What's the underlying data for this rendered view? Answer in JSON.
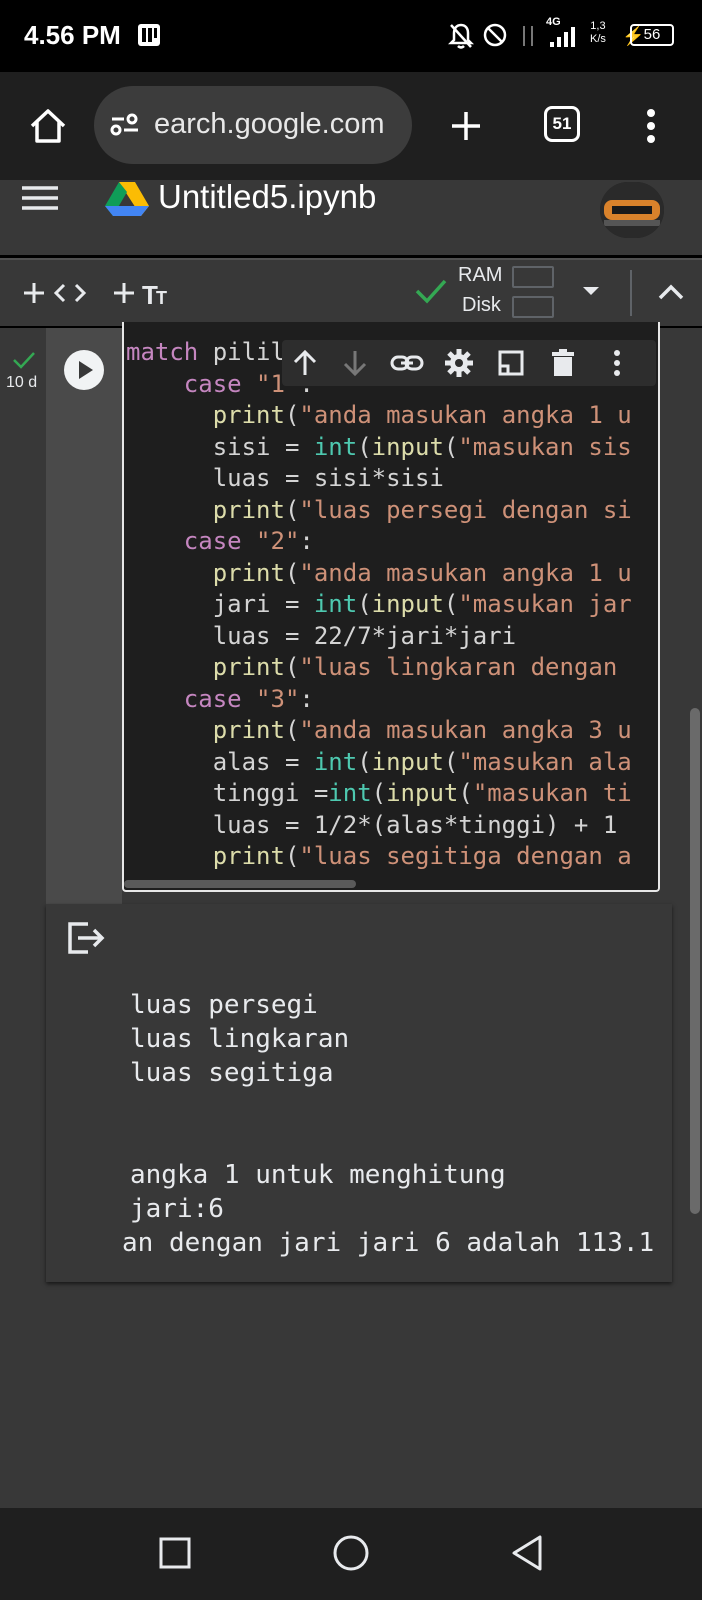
{
  "status_bar": {
    "time": "4.56 PM",
    "network": "4G",
    "speed_value": "1,3",
    "speed_unit": "K/s",
    "battery": "56"
  },
  "browser": {
    "url": "earch.google.com",
    "tab_count": "51"
  },
  "colab": {
    "file_title": "Untitled5.ipynb",
    "resources": {
      "ram_label": "RAM",
      "disk_label": "Disk"
    }
  },
  "cell": {
    "exec_time": "10 d",
    "code_lines": [
      [
        {
          "t": "match",
          "c": "kw"
        },
        {
          "t": " pilil",
          "c": ""
        }
      ],
      [
        {
          "t": "    case ",
          "c": "kw"
        },
        {
          "t": "\"1\"",
          "c": "st"
        },
        {
          "t": ":",
          "c": ""
        }
      ],
      [
        {
          "t": "      ",
          "c": ""
        },
        {
          "t": "print",
          "c": "fn"
        },
        {
          "t": "(",
          "c": ""
        },
        {
          "t": "\"anda masukan angka 1 u",
          "c": "st"
        }
      ],
      [
        {
          "t": "      sisi = ",
          "c": ""
        },
        {
          "t": "int",
          "c": "bi"
        },
        {
          "t": "(",
          "c": ""
        },
        {
          "t": "input",
          "c": "fn"
        },
        {
          "t": "(",
          "c": ""
        },
        {
          "t": "\"masukan sis",
          "c": "st"
        }
      ],
      [
        {
          "t": "      luas = sisi*sisi",
          "c": ""
        }
      ],
      [
        {
          "t": "      ",
          "c": ""
        },
        {
          "t": "print",
          "c": "fn"
        },
        {
          "t": "(",
          "c": ""
        },
        {
          "t": "\"luas persegi dengan si",
          "c": "st"
        }
      ],
      [
        {
          "t": "    case ",
          "c": "kw"
        },
        {
          "t": "\"2\"",
          "c": "st"
        },
        {
          "t": ":",
          "c": ""
        }
      ],
      [
        {
          "t": "      ",
          "c": ""
        },
        {
          "t": "print",
          "c": "fn"
        },
        {
          "t": "(",
          "c": ""
        },
        {
          "t": "\"anda masukan angka 1 u",
          "c": "st"
        }
      ],
      [
        {
          "t": "      jari = ",
          "c": ""
        },
        {
          "t": "int",
          "c": "bi"
        },
        {
          "t": "(",
          "c": ""
        },
        {
          "t": "input",
          "c": "fn"
        },
        {
          "t": "(",
          "c": ""
        },
        {
          "t": "\"masukan jar",
          "c": "st"
        }
      ],
      [
        {
          "t": "      luas = 22/7*jari*jari",
          "c": ""
        }
      ],
      [
        {
          "t": "      ",
          "c": ""
        },
        {
          "t": "print",
          "c": "fn"
        },
        {
          "t": "(",
          "c": ""
        },
        {
          "t": "\"luas lingkaran dengan",
          "c": "st"
        }
      ],
      [
        {
          "t": "    case ",
          "c": "kw"
        },
        {
          "t": "\"3\"",
          "c": "st"
        },
        {
          "t": ":",
          "c": ""
        }
      ],
      [
        {
          "t": "      ",
          "c": ""
        },
        {
          "t": "print",
          "c": "fn"
        },
        {
          "t": "(",
          "c": ""
        },
        {
          "t": "\"anda masukan angka 3 u",
          "c": "st"
        }
      ],
      [
        {
          "t": "      alas = ",
          "c": ""
        },
        {
          "t": "int",
          "c": "bi"
        },
        {
          "t": "(",
          "c": ""
        },
        {
          "t": "input",
          "c": "fn"
        },
        {
          "t": "(",
          "c": ""
        },
        {
          "t": "\"masukan ala",
          "c": "st"
        }
      ],
      [
        {
          "t": "      tinggi =",
          "c": ""
        },
        {
          "t": "int",
          "c": "bi"
        },
        {
          "t": "(",
          "c": ""
        },
        {
          "t": "input",
          "c": "fn"
        },
        {
          "t": "(",
          "c": ""
        },
        {
          "t": "\"masukan ti",
          "c": "st"
        }
      ],
      [
        {
          "t": "      luas = 1/2*(alas*tinggi) + 1",
          "c": ""
        }
      ],
      [
        {
          "t": "      ",
          "c": ""
        },
        {
          "t": "print",
          "c": "fn"
        },
        {
          "t": "(",
          "c": ""
        },
        {
          "t": "\"luas segitiga dengan a",
          "c": "st"
        }
      ]
    ],
    "output_lines": [
      "luas persegi",
      "luas lingkaran",
      "luas segitiga",
      "angka 1 untuk menghitung",
      "jari:6",
      "an dengan jari jari 6 adalah 113.1"
    ]
  },
  "colors": {
    "keyword": "#c586c0",
    "function": "#dcdcaa",
    "builtin": "#4ec9b0",
    "string": "#ce9178",
    "check": "#34a853"
  }
}
